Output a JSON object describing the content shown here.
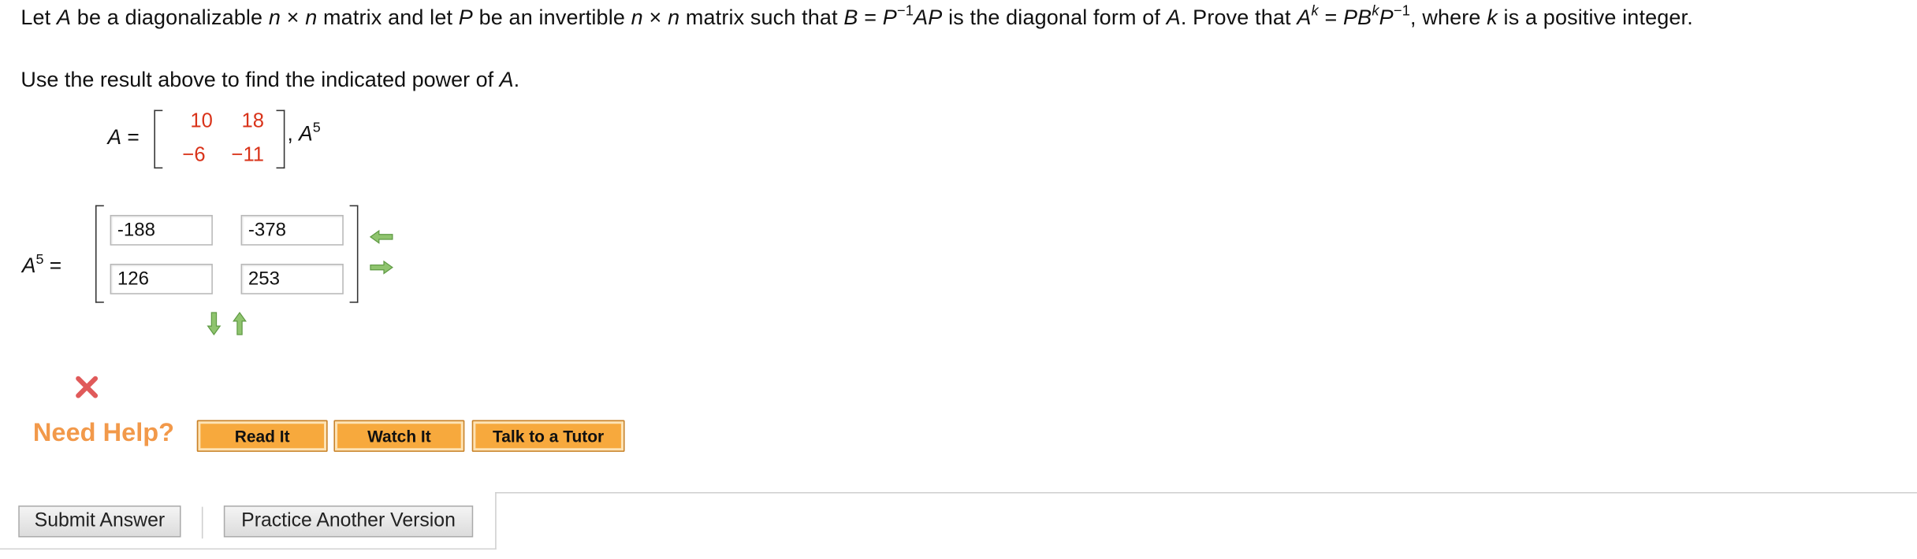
{
  "problem": {
    "part1": "Let ",
    "A": "A",
    "part2": " be a diagonalizable ",
    "n1": "n",
    "times1": " × ",
    "n2": "n",
    "part3": " matrix and let ",
    "P": "P",
    "part4": " be an invertible ",
    "n3": "n",
    "times2": " × ",
    "n4": "n",
    "part5": " matrix such that  ",
    "B": "B",
    "eq1": " = ",
    "P2": "P",
    "inv1": "−1",
    "AP": "AP",
    "part6": "  is the diagonal form of ",
    "A2": "A",
    "part7": ". Prove that  ",
    "A3": "A",
    "k1": "k",
    "eq2": " = ",
    "PB": "PB",
    "k2": "k",
    "P3": "P",
    "inv2": "−1",
    "part8": ",  where ",
    "k3": "k",
    "part9": " is a positive integer."
  },
  "instruction": {
    "text": "Use the result above to find the indicated power of ",
    "var": "A",
    "end": "."
  },
  "given": {
    "lhs_var": "A",
    "lhs_eq": " =",
    "matrix": [
      [
        "10",
        "18"
      ],
      [
        "−6",
        "−11"
      ]
    ],
    "comma": ",",
    "power_var": "A",
    "power_exp": "5"
  },
  "answer": {
    "label_var": "A",
    "label_exp": "5",
    "label_eq": " =",
    "cells": [
      [
        "-188",
        "-378"
      ],
      [
        "126",
        "253"
      ]
    ]
  },
  "help": {
    "label": "Need Help?",
    "read_it": "Read It",
    "watch_it": "Watch It",
    "talk_tutor": "Talk to a Tutor"
  },
  "footer": {
    "submit": "Submit Answer",
    "practice": "Practice Another Version"
  },
  "colors": {
    "matrix_entry": "#d9331a",
    "help_text": "#f2994a",
    "help_button": "#f7a93d",
    "arrow_green": "#7ab55c",
    "incorrect_x": "#e05a5a"
  },
  "icons": {
    "col_arrows": [
      "arrow-left-icon",
      "arrow-right-icon"
    ],
    "row_arrows": [
      "arrow-down-icon",
      "arrow-up-icon"
    ],
    "status": "incorrect-x-icon"
  }
}
